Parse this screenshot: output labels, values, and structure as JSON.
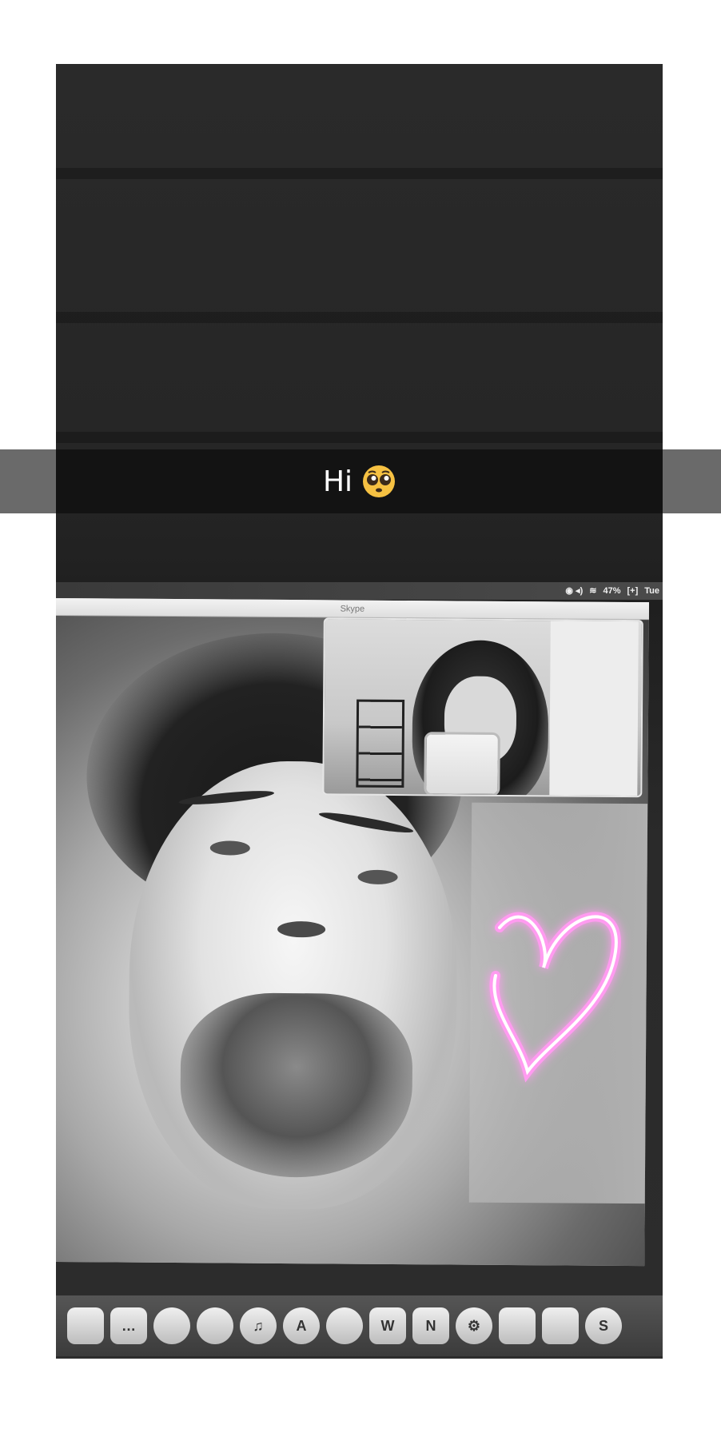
{
  "caption": {
    "text": "Hi"
  },
  "menubar": {
    "battery": "47%",
    "day": "Tue"
  },
  "skype": {
    "window_title": "Skype"
  },
  "dock": {
    "apps": [
      {
        "name": "finder-icon",
        "glyph": ""
      },
      {
        "name": "messages-icon",
        "glyph": "…"
      },
      {
        "name": "facetime-icon",
        "glyph": ""
      },
      {
        "name": "chrome-icon",
        "glyph": ""
      },
      {
        "name": "itunes-icon",
        "glyph": "♫"
      },
      {
        "name": "appstore-icon",
        "glyph": "A"
      },
      {
        "name": "spotify-icon",
        "glyph": ""
      },
      {
        "name": "word-icon",
        "glyph": "W"
      },
      {
        "name": "onenote-icon",
        "glyph": "N"
      },
      {
        "name": "system-preferences-icon",
        "glyph": "⚙"
      },
      {
        "name": "notes-icon",
        "glyph": ""
      },
      {
        "name": "preview-icon",
        "glyph": ""
      },
      {
        "name": "skype-icon",
        "glyph": "S"
      }
    ]
  },
  "colors": {
    "heart": "#ff9bf0",
    "caption_bg": "#131313"
  }
}
